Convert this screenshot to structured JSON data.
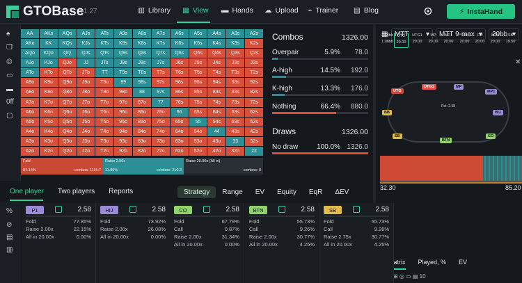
{
  "header": {
    "brand": "GTOBase",
    "version": "v1.27",
    "nav": [
      {
        "label": "Library",
        "icon": "library-icon"
      },
      {
        "label": "View",
        "icon": "view-icon"
      },
      {
        "label": "Hands",
        "icon": "hands-icon"
      },
      {
        "label": "Upload",
        "icon": "upload-icon"
      },
      {
        "label": "Trainer",
        "icon": "trainer-icon"
      },
      {
        "label": "Blog",
        "icon": "blog-icon"
      }
    ],
    "active": "View",
    "cta": "InstaHand"
  },
  "grid": {
    "hands": [
      [
        "AA",
        "AKs",
        "AQs",
        "AJs",
        "ATs",
        "A9s",
        "A8s",
        "A7s",
        "A6s",
        "A5s",
        "A4s",
        "A3s",
        "A2s"
      ],
      [
        "AKo",
        "KK",
        "KQs",
        "KJs",
        "KTs",
        "K9s",
        "K8s",
        "K7s",
        "K6s",
        "K5s",
        "K4s",
        "K3s",
        "K2s"
      ],
      [
        "AQo",
        "KQo",
        "QQ",
        "QJs",
        "QTs",
        "Q9s",
        "Q8s",
        "Q7s",
        "Q6s",
        "Q5s",
        "Q4s",
        "Q3s",
        "Q2s"
      ],
      [
        "AJo",
        "KJo",
        "QJo",
        "JJ",
        "JTs",
        "J9s",
        "J8s",
        "J7s",
        "J6s",
        "J5s",
        "J4s",
        "J3s",
        "J2s"
      ],
      [
        "ATo",
        "KTo",
        "QTo",
        "JTo",
        "TT",
        "T9s",
        "T8s",
        "T7s",
        "T6s",
        "T5s",
        "T4s",
        "T3s",
        "T2s"
      ],
      [
        "A9o",
        "K9o",
        "Q9o",
        "J9o",
        "T9o",
        "99",
        "98s",
        "97s",
        "96s",
        "95s",
        "94s",
        "93s",
        "92s"
      ],
      [
        "A8o",
        "K8o",
        "Q8o",
        "J8o",
        "T8o",
        "98o",
        "88",
        "87s",
        "86s",
        "85s",
        "84s",
        "83s",
        "82s"
      ],
      [
        "A7o",
        "K7o",
        "Q7o",
        "J7o",
        "T7o",
        "97o",
        "87o",
        "77",
        "76s",
        "75s",
        "74s",
        "73s",
        "72s"
      ],
      [
        "A6o",
        "K6o",
        "Q6o",
        "J6o",
        "T6o",
        "96o",
        "86o",
        "76o",
        "66",
        "65s",
        "64s",
        "63s",
        "62s"
      ],
      [
        "A5o",
        "K5o",
        "Q5o",
        "J5o",
        "T5o",
        "95o",
        "85o",
        "75o",
        "65o",
        "55",
        "54s",
        "53s",
        "52s"
      ],
      [
        "A4o",
        "K4o",
        "Q4o",
        "J4o",
        "T4o",
        "94o",
        "84o",
        "74o",
        "64o",
        "54o",
        "44",
        "43s",
        "42s"
      ],
      [
        "A3o",
        "K3o",
        "Q3o",
        "J3o",
        "T3o",
        "93o",
        "83o",
        "73o",
        "63o",
        "53o",
        "43o",
        "33",
        "32s"
      ],
      [
        "A2o",
        "K2o",
        "Q2o",
        "J2o",
        "T2o",
        "92o",
        "82o",
        "72o",
        "62o",
        "52o",
        "42o",
        "32o",
        "22"
      ]
    ],
    "raise_cells": [
      "AA",
      "AKs",
      "AQs",
      "AJs",
      "ATs",
      "A9s",
      "A8s",
      "A7s",
      "A6s",
      "A5s",
      "A4s",
      "A3s",
      "A2s",
      "AKo",
      "KK",
      "KQs",
      "KJs",
      "KTs",
      "K9s",
      "K8s",
      "K7s",
      "K6s",
      "K5s",
      "K4s",
      "K3s",
      "AQo",
      "KQo",
      "QQ",
      "QJs",
      "QTs",
      "Q9s",
      "Q8s",
      "Q7s",
      "Q6s",
      "AJo",
      "KJo",
      "JJ",
      "JTs",
      "J9s",
      "J8s",
      "J7s",
      "ATo",
      "TT",
      "T9s",
      "T8s",
      "99",
      "98s",
      "88",
      "87s",
      "77",
      "66",
      "55",
      "44",
      "33",
      "22"
    ],
    "colors": {
      "raise": "#2c8f95",
      "fold": "#d9503a",
      "mixed": "#7a3f3f"
    }
  },
  "summary": [
    {
      "label": "Fold",
      "pct": "84.14%",
      "combos": "combos: 1115.7",
      "color": "#c94a34"
    },
    {
      "label": "Raise 2.00x",
      "pct": "11.86%",
      "combos": "combos: 210.3",
      "color": "#2c8f95"
    },
    {
      "label": "Raise 20.00x (All in)",
      "pct": "",
      "combos": "combos: 0",
      "color": "#2a2f36"
    }
  ],
  "stats": {
    "combos_title": "Combos",
    "combos_total": "1326.00",
    "rows": [
      {
        "label": "Overpair",
        "pct": "5.9%",
        "val": "78.0",
        "fill": 0.06
      },
      {
        "label": "A-high",
        "pct": "14.5%",
        "val": "192.0",
        "fill": 0.145
      },
      {
        "label": "K-high",
        "pct": "13.3%",
        "val": "176.0",
        "fill": 0.133
      },
      {
        "label": "Nothing",
        "pct": "66.4%",
        "val": "880.0",
        "fill": 0.664
      }
    ],
    "draws_title": "Draws",
    "draws_total": "1326.00",
    "draw_rows": [
      {
        "label": "No draw",
        "pct": "100.0%",
        "val": "1326.0",
        "fill": 1.0
      }
    ]
  },
  "right": {
    "game": "MTT",
    "format": "MTT 9-max",
    "stack": "20bb",
    "positions": [
      {
        "top": "2.58bb",
        "bot": "1.08bb"
      },
      {
        "top": "UTG",
        "bot": "20.00"
      },
      {
        "top": "UTG1",
        "bot": "20.00"
      },
      {
        "top": "MP",
        "bot": "20.00"
      },
      {
        "top": "MP1",
        "bot": "20.00"
      },
      {
        "top": "HIJ",
        "bot": "20.00"
      },
      {
        "top": "CO",
        "bot": "20.00"
      },
      {
        "top": "BTN",
        "bot": "20.00"
      },
      {
        "top": "SB",
        "bot": "19.50"
      }
    ],
    "pot": "Pot: 2.58",
    "eq_low": "32.30",
    "eq_high": "85.20",
    "tabs": [
      "Matrix",
      "Played, %",
      "EV"
    ]
  },
  "modes": [
    "One player",
    "Two players",
    "Reports"
  ],
  "strategy_tabs": [
    "Strategy",
    "Range",
    "EV",
    "Equity",
    "EqR",
    "ΔEV"
  ],
  "players": [
    {
      "pos": "P1",
      "val": "2.58",
      "rows": [
        [
          "Fold",
          "77.85%"
        ],
        [
          "Raise 2.00x",
          "22.15%"
        ],
        [
          "All in 20.00x",
          "0.00%"
        ]
      ],
      "color": "#9a8bd9"
    },
    {
      "pos": "HIJ",
      "val": "2.58",
      "rows": [
        [
          "Fold",
          "73.92%"
        ],
        [
          "Raise 2.00x",
          "26.08%"
        ],
        [
          "All in 20.00x",
          "0.00%"
        ]
      ],
      "color": "#9a8bd9"
    },
    {
      "pos": "CO",
      "val": "2.58",
      "rows": [
        [
          "Fold",
          "67.79%"
        ],
        [
          "Call",
          "0.87%"
        ],
        [
          "Raise 2.00x",
          "31.34%"
        ],
        [
          "All in 20.00x",
          "0.00%"
        ]
      ],
      "color": "#8fd36a"
    },
    {
      "pos": "BTN",
      "val": "2.58",
      "rows": [
        [
          "Fold",
          "55.73%"
        ],
        [
          "Call",
          "9.26%"
        ],
        [
          "Raise 2.00x",
          "30.77%"
        ],
        [
          "All in 20.00x",
          "4.25%"
        ]
      ],
      "color": "#8fd36a"
    },
    {
      "pos": "SB",
      "val": "2.58",
      "rows": [
        [
          "Fold",
          "55.73%"
        ],
        [
          "Call",
          "9.26%"
        ],
        [
          "Raise 2.75x",
          "30.77%"
        ],
        [
          "All in 20.00x",
          "4.25%"
        ]
      ],
      "color": "#e2b94b"
    }
  ]
}
